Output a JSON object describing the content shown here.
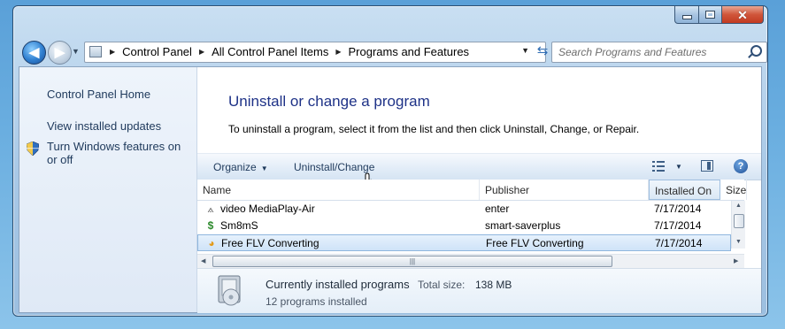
{
  "window": {
    "controls": {
      "minimize_icon": "minimize-icon",
      "maximize_icon": "maximize-icon",
      "close_icon": "close-icon",
      "close_color": "#c23b22"
    }
  },
  "nav": {
    "back_icon": "arrow-left-icon",
    "forward_icon": "arrow-right-icon",
    "breadcrumb": [
      "Control Panel",
      "All Control Panel Items",
      "Programs and Features"
    ],
    "search_placeholder": "Search Programs and Features"
  },
  "sidebar": {
    "home": "Control Panel Home",
    "links": [
      "View installed updates",
      "Turn Windows features on or off"
    ]
  },
  "main": {
    "title": "Uninstall or change a program",
    "description": "To uninstall a program, select it from the list and then click Uninstall, Change, or Repair."
  },
  "toolbar": {
    "organize": "Organize",
    "uninstall_change": "Uninstall/Change",
    "help": "?"
  },
  "table": {
    "columns": [
      "Name",
      "Publisher",
      "Installed On",
      "Size"
    ],
    "rows": [
      {
        "name": "video MediaPlay-Air",
        "publisher": "enter",
        "installed_on": "7/17/2014",
        "icon": "program-icon"
      },
      {
        "name": "Sm8mS",
        "publisher": "smart-saverplus",
        "installed_on": "7/17/2014",
        "icon": "program-icon"
      },
      {
        "name": "Free FLV Converting",
        "publisher": "Free FLV Converting",
        "installed_on": "7/17/2014",
        "icon": "program-icon",
        "selected": true
      }
    ]
  },
  "details": {
    "title": "Currently installed programs",
    "total_size_label": "Total size:",
    "total_size": "138 MB",
    "count": "12 programs installed"
  },
  "colors": {
    "link": "#1e395b",
    "title": "#1e3287",
    "selection": "#cfe3f8"
  }
}
